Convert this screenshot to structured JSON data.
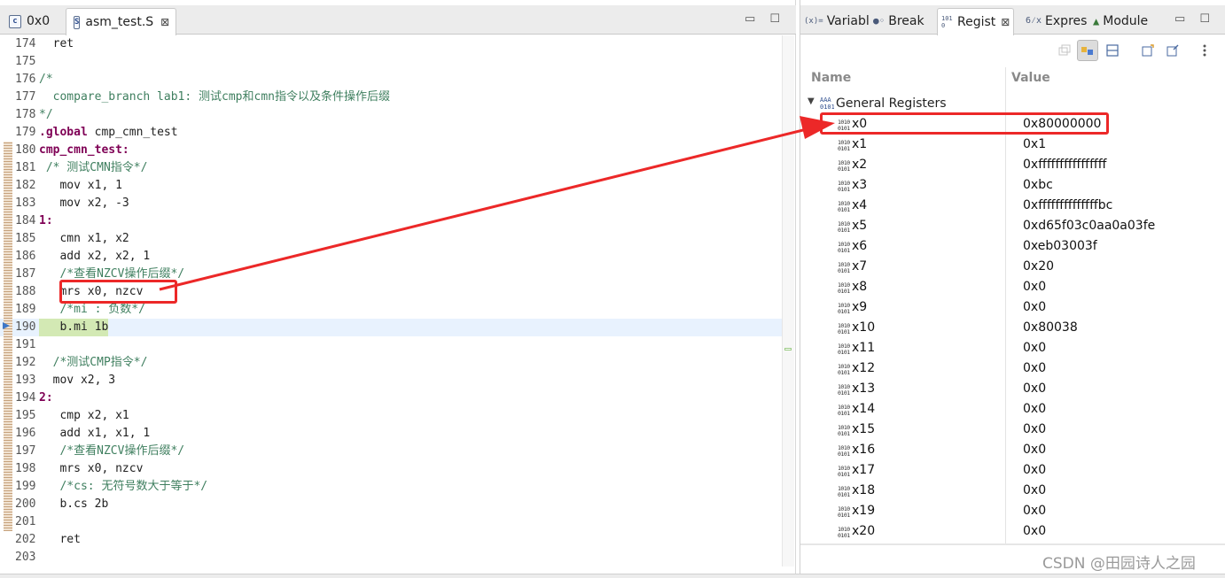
{
  "editor": {
    "tabs": [
      {
        "label": "0x0",
        "icon": "c-file-icon",
        "icon_text": "c"
      },
      {
        "label": "asm_test.S",
        "icon": "source-file-icon",
        "icon_text": "S",
        "close": "⊠"
      }
    ],
    "window_controls": {
      "minimize": "▭",
      "maximize": "☐"
    },
    "lines": [
      {
        "num": "174",
        "text": "  ret",
        "style": "code"
      },
      {
        "num": "175",
        "text": "",
        "style": "code"
      },
      {
        "num": "176",
        "text": "/*",
        "style": "comment"
      },
      {
        "num": "177",
        "text": "  compare_branch lab1: 测试cmp和cmn指令以及条件操作后缀",
        "style": "comment"
      },
      {
        "num": "178",
        "text": "*/",
        "style": "comment"
      },
      {
        "num": "179",
        "text": ".global cmp_cmn_test",
        "style": "directive"
      },
      {
        "num": "180",
        "text": "cmp_cmn_test:",
        "style": "label"
      },
      {
        "num": "181",
        "text": " /* 测试CMN指令*/",
        "style": "comment"
      },
      {
        "num": "182",
        "text": "   mov x1, 1",
        "style": "code"
      },
      {
        "num": "183",
        "text": "   mov x2, -3",
        "style": "code"
      },
      {
        "num": "184",
        "text": "1:",
        "style": "label"
      },
      {
        "num": "185",
        "text": "   cmn x1, x2",
        "style": "code"
      },
      {
        "num": "186",
        "text": "   add x2, x2, 1",
        "style": "code"
      },
      {
        "num": "187",
        "text": "   /*查看NZCV操作后缀*/",
        "style": "comment"
      },
      {
        "num": "188",
        "text": "   mrs x0, nzcv",
        "style": "code"
      },
      {
        "num": "189",
        "text": "   /*mi : 负数*/",
        "style": "comment"
      },
      {
        "num": "190",
        "text": "   b.mi 1b",
        "style": "current"
      },
      {
        "num": "191",
        "text": "",
        "style": "code"
      },
      {
        "num": "192",
        "text": "  /*测试CMP指令*/",
        "style": "comment"
      },
      {
        "num": "193",
        "text": "  mov x2, 3",
        "style": "code"
      },
      {
        "num": "194",
        "text": "2:",
        "style": "label"
      },
      {
        "num": "195",
        "text": "   cmp x2, x1",
        "style": "code"
      },
      {
        "num": "196",
        "text": "   add x1, x1, 1",
        "style": "code"
      },
      {
        "num": "197",
        "text": "   /*查看NZCV操作后缀*/",
        "style": "comment"
      },
      {
        "num": "198",
        "text": "   mrs x0, nzcv",
        "style": "code"
      },
      {
        "num": "199",
        "text": "   /*cs: 无符号数大于等于*/",
        "style": "comment"
      },
      {
        "num": "200",
        "text": "   b.cs 2b",
        "style": "code"
      },
      {
        "num": "201",
        "text": "",
        "style": "code"
      },
      {
        "num": "202",
        "text": "   ret",
        "style": "code"
      },
      {
        "num": "203",
        "text": "",
        "style": "code"
      }
    ]
  },
  "registers": {
    "tabs": [
      {
        "icon_text": "(x)=",
        "label": "Variabl"
      },
      {
        "icon_text": "●◦",
        "label": "Break"
      },
      {
        "icon_text": "1010",
        "label": "Regist",
        "close": "⊠"
      },
      {
        "icon_text": "6⁄x",
        "label": "Expres"
      },
      {
        "icon_text": "▲",
        "label": "Module"
      }
    ],
    "window_controls": {
      "minimize": "▭",
      "maximize": "☐"
    },
    "columns": {
      "name": "Name",
      "value": "Value"
    },
    "group": {
      "arrow": "▼",
      "label": "General Registers"
    },
    "rows": [
      {
        "name": "x0",
        "value": "0x80000000"
      },
      {
        "name": "x1",
        "value": "0x1"
      },
      {
        "name": "x2",
        "value": "0xffffffffffffffff"
      },
      {
        "name": "x3",
        "value": "0xbc"
      },
      {
        "name": "x4",
        "value": "0xffffffffffffffbc"
      },
      {
        "name": "x5",
        "value": "0xd65f03c0aa0a03fe"
      },
      {
        "name": "x6",
        "value": "0xeb03003f"
      },
      {
        "name": "x7",
        "value": "0x20"
      },
      {
        "name": "x8",
        "value": "0x0"
      },
      {
        "name": "x9",
        "value": "0x0"
      },
      {
        "name": "x10",
        "value": "0x80038"
      },
      {
        "name": "x11",
        "value": "0x0"
      },
      {
        "name": "x12",
        "value": "0x0"
      },
      {
        "name": "x13",
        "value": "0x0"
      },
      {
        "name": "x14",
        "value": "0x0"
      },
      {
        "name": "x15",
        "value": "0x0"
      },
      {
        "name": "x16",
        "value": "0x0"
      },
      {
        "name": "x17",
        "value": "0x0"
      },
      {
        "name": "x18",
        "value": "0x0"
      },
      {
        "name": "x19",
        "value": "0x0"
      },
      {
        "name": "x20",
        "value": "0x0"
      }
    ]
  },
  "annotation_color": "#ec2828",
  "watermark": "CSDN @田园诗人之园"
}
